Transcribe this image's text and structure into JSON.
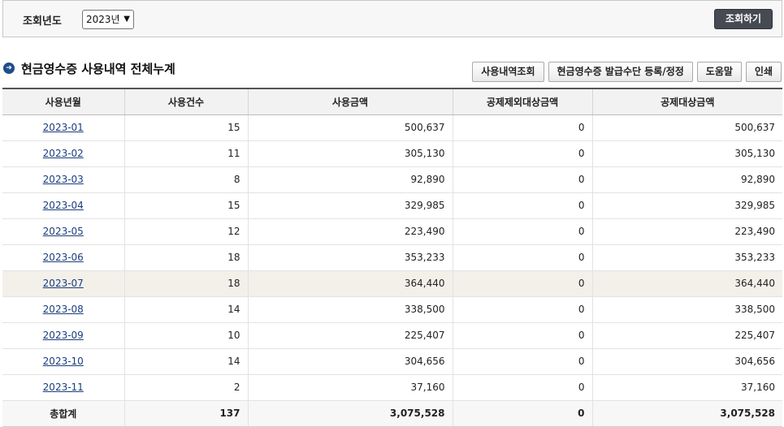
{
  "search": {
    "label": "조회년도",
    "year_value": "2023년",
    "search_button": "조회하기"
  },
  "section": {
    "title": "현금영수증 사용내역 전체누계"
  },
  "toolbar": {
    "history_button": "사용내역조회",
    "register_button": "현금영수증 발급수단 등록/정정",
    "help_button": "도움말",
    "print_button": "인쇄"
  },
  "table": {
    "headers": [
      "사용년월",
      "사용건수",
      "사용금액",
      "공제제외대상금액",
      "공제대상금액"
    ],
    "rows": [
      {
        "month": "2023-01",
        "count": "15",
        "amount": "500,637",
        "excluded": "0",
        "deductible": "500,637"
      },
      {
        "month": "2023-02",
        "count": "11",
        "amount": "305,130",
        "excluded": "0",
        "deductible": "305,130"
      },
      {
        "month": "2023-03",
        "count": "8",
        "amount": "92,890",
        "excluded": "0",
        "deductible": "92,890"
      },
      {
        "month": "2023-04",
        "count": "15",
        "amount": "329,985",
        "excluded": "0",
        "deductible": "329,985"
      },
      {
        "month": "2023-05",
        "count": "12",
        "amount": "223,490",
        "excluded": "0",
        "deductible": "223,490"
      },
      {
        "month": "2023-06",
        "count": "18",
        "amount": "353,233",
        "excluded": "0",
        "deductible": "353,233"
      },
      {
        "month": "2023-07",
        "count": "18",
        "amount": "364,440",
        "excluded": "0",
        "deductible": "364,440"
      },
      {
        "month": "2023-08",
        "count": "14",
        "amount": "338,500",
        "excluded": "0",
        "deductible": "338,500"
      },
      {
        "month": "2023-09",
        "count": "10",
        "amount": "225,407",
        "excluded": "0",
        "deductible": "225,407"
      },
      {
        "month": "2023-10",
        "count": "14",
        "amount": "304,656",
        "excluded": "0",
        "deductible": "304,656"
      },
      {
        "month": "2023-11",
        "count": "2",
        "amount": "37,160",
        "excluded": "0",
        "deductible": "37,160"
      }
    ],
    "total": {
      "label": "총합계",
      "count": "137",
      "amount": "3,075,528",
      "excluded": "0",
      "deductible": "3,075,528"
    }
  },
  "colors": {
    "accent": "#1f4e8c",
    "search_button_bg": "#464a52",
    "highlight_row": "#f3f0ea",
    "link": "#1a3d7c"
  },
  "icons": {
    "title_icon": "arrow-circle-icon",
    "select_caret": "chevron-down-icon"
  }
}
